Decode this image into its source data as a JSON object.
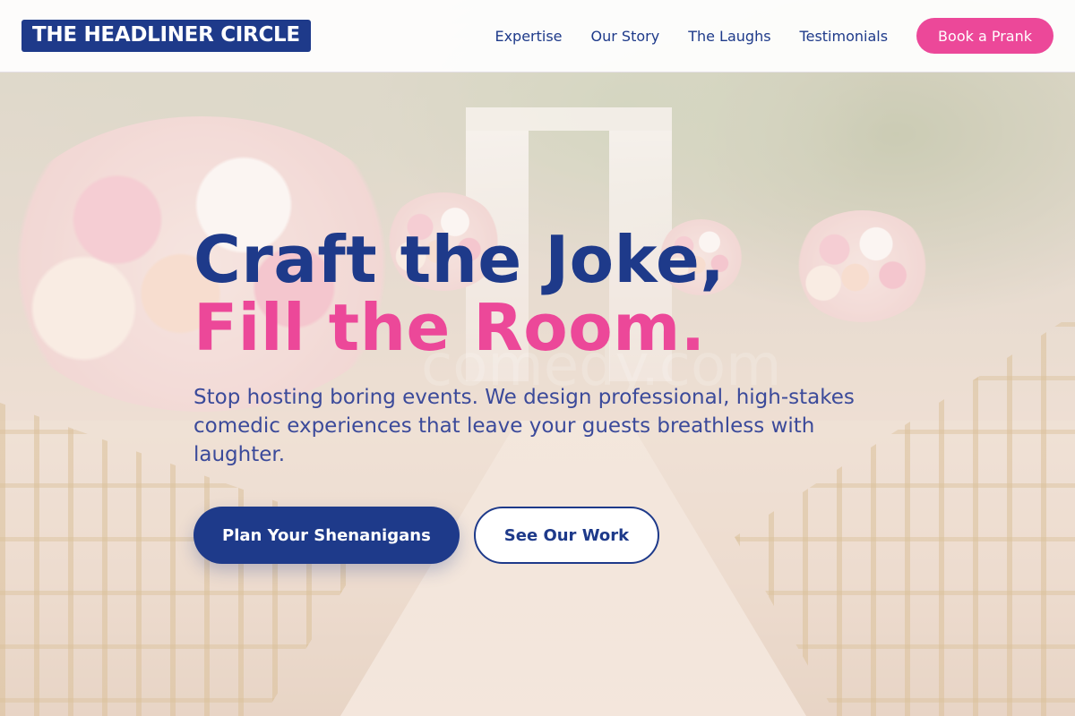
{
  "brand": {
    "name": "THE HEADLINER CIRCLE"
  },
  "nav": {
    "items": [
      {
        "label": "Expertise"
      },
      {
        "label": "Our Story"
      },
      {
        "label": "The Laughs"
      },
      {
        "label": "Testimonials"
      }
    ],
    "cta_label": "Book a Prank"
  },
  "hero": {
    "headline_line1": "Craft the Joke,",
    "headline_line2": "Fill the Room.",
    "subtitle": "Stop hosting boring events. We design professional, high-stakes comedic experiences that leave your guests breathless with laughter.",
    "primary_cta": "Plan Your Shenanigans",
    "secondary_cta": "See Our Work",
    "background_watermark": "comedy.com"
  },
  "colors": {
    "navy": "#1e3a8a",
    "pink": "#ec4899",
    "white": "#ffffff"
  }
}
